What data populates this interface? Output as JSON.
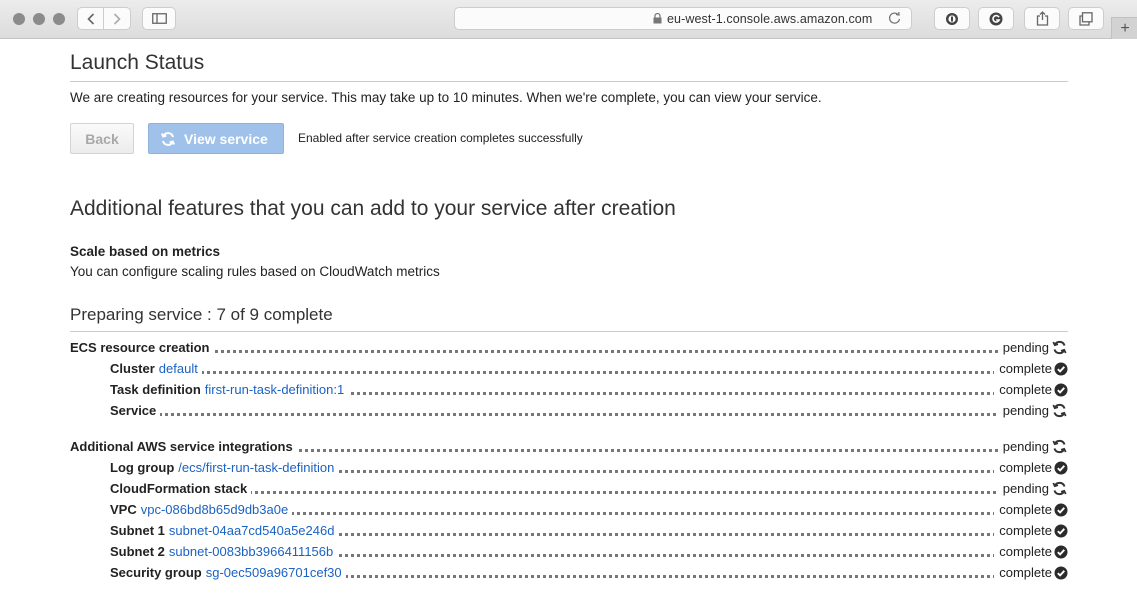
{
  "browser": {
    "url": "eu-west-1.console.aws.amazon.com",
    "new_tab_label": "+"
  },
  "launch": {
    "title": "Launch Status",
    "info": "We are creating resources for your service. This may take up to 10 minutes. When we're complete, you can view your service.",
    "back_label": "Back",
    "view_label": "View service",
    "hint": "Enabled after service creation completes successfully"
  },
  "features": {
    "title": "Additional features that you can add to your service after creation",
    "scale_title": "Scale based on metrics",
    "scale_desc": "You can configure scaling rules based on CloudWatch metrics"
  },
  "progress": {
    "title": "Preparing service : 7 of 9 complete",
    "completed": 7,
    "total": 9
  },
  "groups": [
    {
      "label": "ECS resource creation",
      "status": "pending",
      "items": [
        {
          "label": "Cluster",
          "link": "default",
          "status": "complete"
        },
        {
          "label": "Task definition",
          "link": "first-run-task-definition:1",
          "status": "complete"
        },
        {
          "label": "Service",
          "link": "",
          "status": "pending"
        }
      ]
    },
    {
      "label": "Additional AWS service integrations",
      "status": "pending",
      "items": [
        {
          "label": "Log group",
          "link": "/ecs/first-run-task-definition",
          "status": "complete"
        },
        {
          "label": "CloudFormation stack",
          "link": "",
          "status": "pending"
        },
        {
          "label": "VPC",
          "link": "vpc-086bd8b65d9db3a0e",
          "status": "complete"
        },
        {
          "label": "Subnet 1",
          "link": "subnet-04aa7cd540a5e246d",
          "status": "complete"
        },
        {
          "label": "Subnet 2",
          "link": "subnet-0083bb3966411156b",
          "status": "complete"
        },
        {
          "label": "Security group",
          "link": "sg-0ec509a96701cef30",
          "status": "complete"
        }
      ]
    }
  ]
}
